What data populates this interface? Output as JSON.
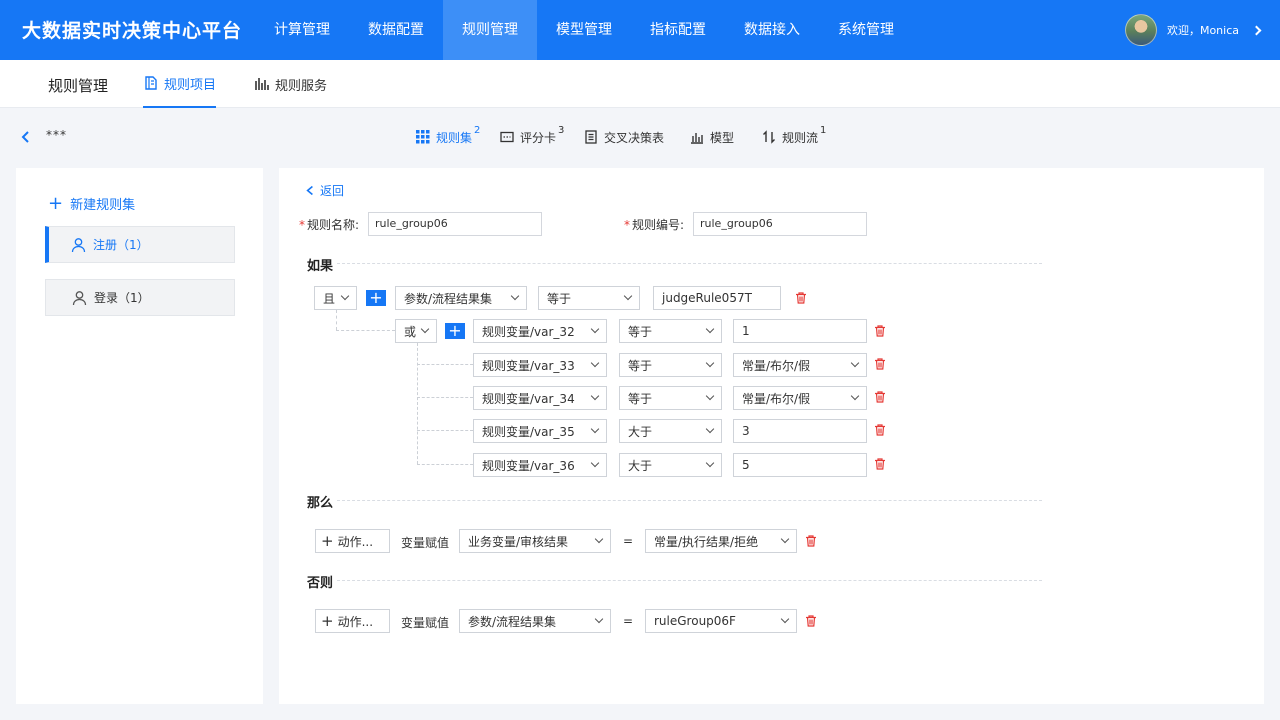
{
  "app": {
    "title": "大数据实时决策中心平台"
  },
  "nav": {
    "items": [
      "计算管理",
      "数据配置",
      "规则管理",
      "模型管理",
      "指标配置",
      "数据接入",
      "系统管理"
    ],
    "active_index": 2
  },
  "user": {
    "greeting": "欢迎，Monica"
  },
  "subnav": {
    "title": "规则管理",
    "tabs": [
      "规则项目",
      "规则服务"
    ]
  },
  "breadcrumb": {
    "ellipsis": "***"
  },
  "type_tabs": [
    {
      "label": "规则集",
      "count": "2"
    },
    {
      "label": "评分卡",
      "count": "3"
    },
    {
      "label": "交叉决策表",
      "count": ""
    },
    {
      "label": "模型",
      "count": ""
    },
    {
      "label": "规则流",
      "count": "1"
    }
  ],
  "left_panel": {
    "new_label": "新建规则集",
    "items": [
      "注册（1）",
      "登录（1）"
    ]
  },
  "editor": {
    "back_label": "返回",
    "rule_name_label": "规则名称:",
    "rule_name_value": "rule_group06",
    "rule_code_label": "规则编号:",
    "rule_code_value": "rule_group06",
    "if_title": "如果",
    "then_title": "那么",
    "else_title": "否则",
    "top_condition": {
      "logic": "且",
      "field": "参数/流程结果集",
      "operator": "等于",
      "value": "judgeRule057T"
    },
    "nested": {
      "logic": "或",
      "conditions": [
        {
          "field": "规则变量/var_32",
          "operator": "等于",
          "value": "1",
          "value_type": "input"
        },
        {
          "field": "规则变量/var_33",
          "operator": "等于",
          "value": "常量/布尔/假",
          "value_type": "select"
        },
        {
          "field": "规则变量/var_34",
          "operator": "等于",
          "value": "常量/布尔/假",
          "value_type": "select"
        },
        {
          "field": "规则变量/var_35",
          "operator": "大于",
          "value": "3",
          "value_type": "input"
        },
        {
          "field": "规则变量/var_36",
          "operator": "大于",
          "value": "5",
          "value_type": "input"
        }
      ]
    },
    "then_action": {
      "button": "动作...",
      "assign_label": "变量赋值",
      "target": "业务变量/审核结果",
      "equals": "=",
      "value": "常量/执行结果/拒绝"
    },
    "else_action": {
      "button": "动作...",
      "assign_label": "变量赋值",
      "target": "参数/流程结果集",
      "equals": "=",
      "value": "ruleGroup06F"
    }
  },
  "colors": {
    "primary": "#1677f5",
    "danger": "#e53935"
  }
}
